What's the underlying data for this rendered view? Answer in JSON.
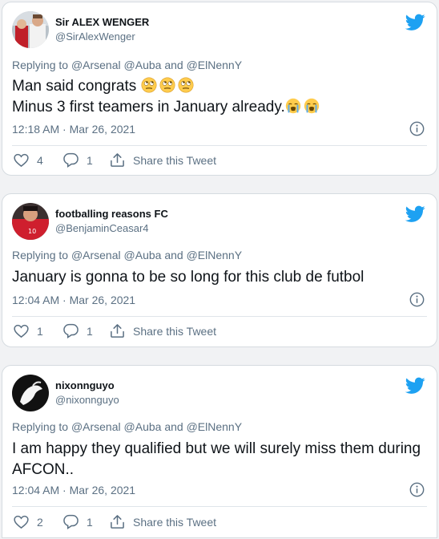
{
  "tweets": [
    {
      "name": "Sir ALEX WENGER",
      "handle": "@SirAlexWenger",
      "replying_prefix": "Replying to",
      "mentions": [
        "@Arsenal",
        "@Auba",
        "@ElNennY"
      ],
      "mentions_joiner": "and",
      "text_lines": [
        "Man said congrats",
        "Minus 3 first teamers in January already."
      ],
      "emoji_line1": "rolling-eyes-face x3",
      "emoji_line2": "loudly-crying-face x2",
      "timestamp": "12:18 AM · Mar 26, 2021",
      "likes": "4",
      "replies": "1",
      "share_label": "Share this Tweet"
    },
    {
      "name": "footballing reasons FC",
      "handle": "@BenjaminCeasar4",
      "replying_prefix": "Replying to",
      "mentions": [
        "@Arsenal",
        "@Auba",
        "@ElNennY"
      ],
      "mentions_joiner": "and",
      "text": "January is gonna to be so long for this club de futbol",
      "timestamp": "12:04 AM · Mar 26, 2021",
      "likes": "1",
      "replies": "1",
      "share_label": "Share this Tweet"
    },
    {
      "name": "nixonnguyo",
      "handle": "@nixonnguyo",
      "replying_prefix": "Replying to",
      "mentions": [
        "@Arsenal",
        "@Auba",
        "@ElNennY"
      ],
      "mentions_joiner": "and",
      "text": "I am happy they qualified but we will surely miss them during AFCON..",
      "timestamp": "12:04 AM · Mar 26, 2021",
      "likes": "2",
      "replies": "1",
      "share_label": "Share this Tweet"
    }
  ],
  "colors": {
    "twitter_blue": "#1DA1F2",
    "secondary_text": "#5b7083",
    "primary_text": "#0f1419",
    "border": "#d5dbe0",
    "background": "#f1f2f4"
  }
}
